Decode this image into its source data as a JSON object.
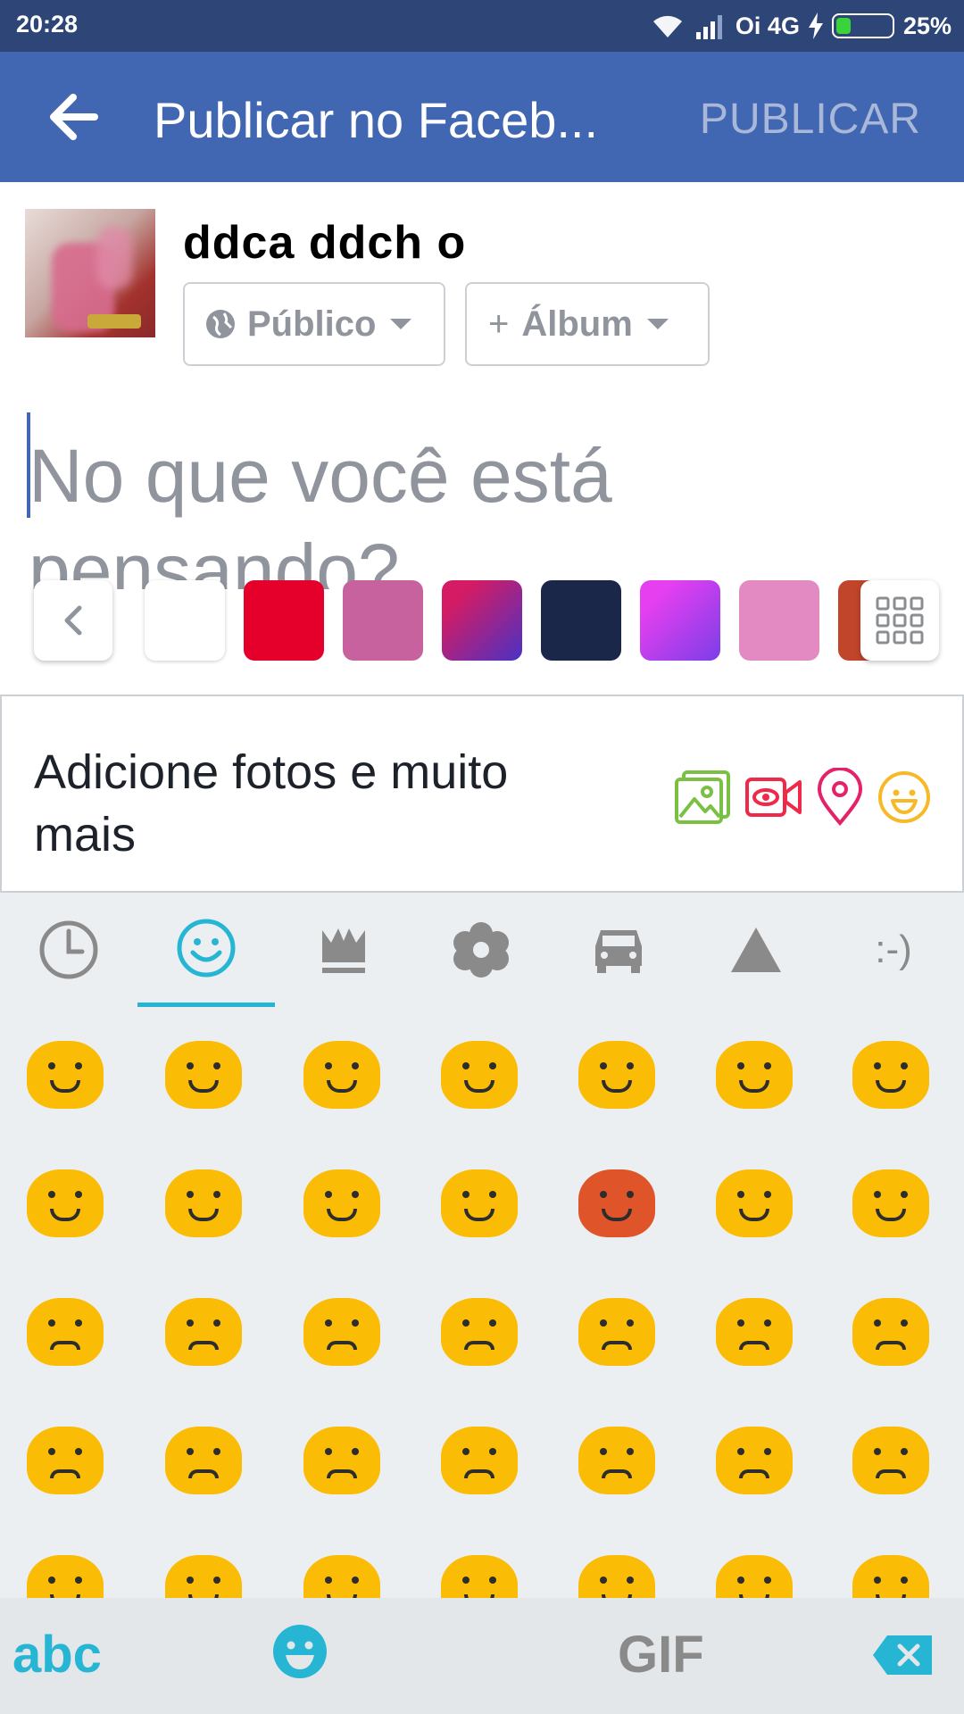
{
  "status_bar": {
    "time": "20:28",
    "carrier": "Oi 4G",
    "battery": "25%",
    "battery_level": 0.25
  },
  "app_bar": {
    "title": "Publicar no Faceb...",
    "publish_label": "PUBLICAR"
  },
  "composer": {
    "username": "ddca ddch o",
    "privacy_label": "Público",
    "album_label": "Álbum",
    "album_plus": "+",
    "placeholder": "No que você está pensando?"
  },
  "backgrounds": {
    "swatches": [
      "#ffffff",
      "#e4002b",
      "#c8629e",
      "gradient-blue-red",
      "#1b2749",
      "gradient-purple",
      "#e28ac1",
      "#c0452a"
    ]
  },
  "add_bar": {
    "label": "Adicione fotos e muito mais",
    "icons": [
      "photo-icon",
      "video-icon",
      "location-pin-icon",
      "feeling-emoji-icon"
    ]
  },
  "keyboard": {
    "tabs": [
      "recent-clock-icon",
      "smiley-icon",
      "crown-icon",
      "flower-icon",
      "car-icon",
      "triangle-icon",
      ":-)"
    ],
    "abc_label": "abc",
    "gif_label": "GIF"
  },
  "colors": {
    "status_bar": "#2e4578",
    "app_bar": "#4267b2",
    "accent_keyboard": "#26b6d4",
    "emoji_yellow": "#fbbc05"
  }
}
